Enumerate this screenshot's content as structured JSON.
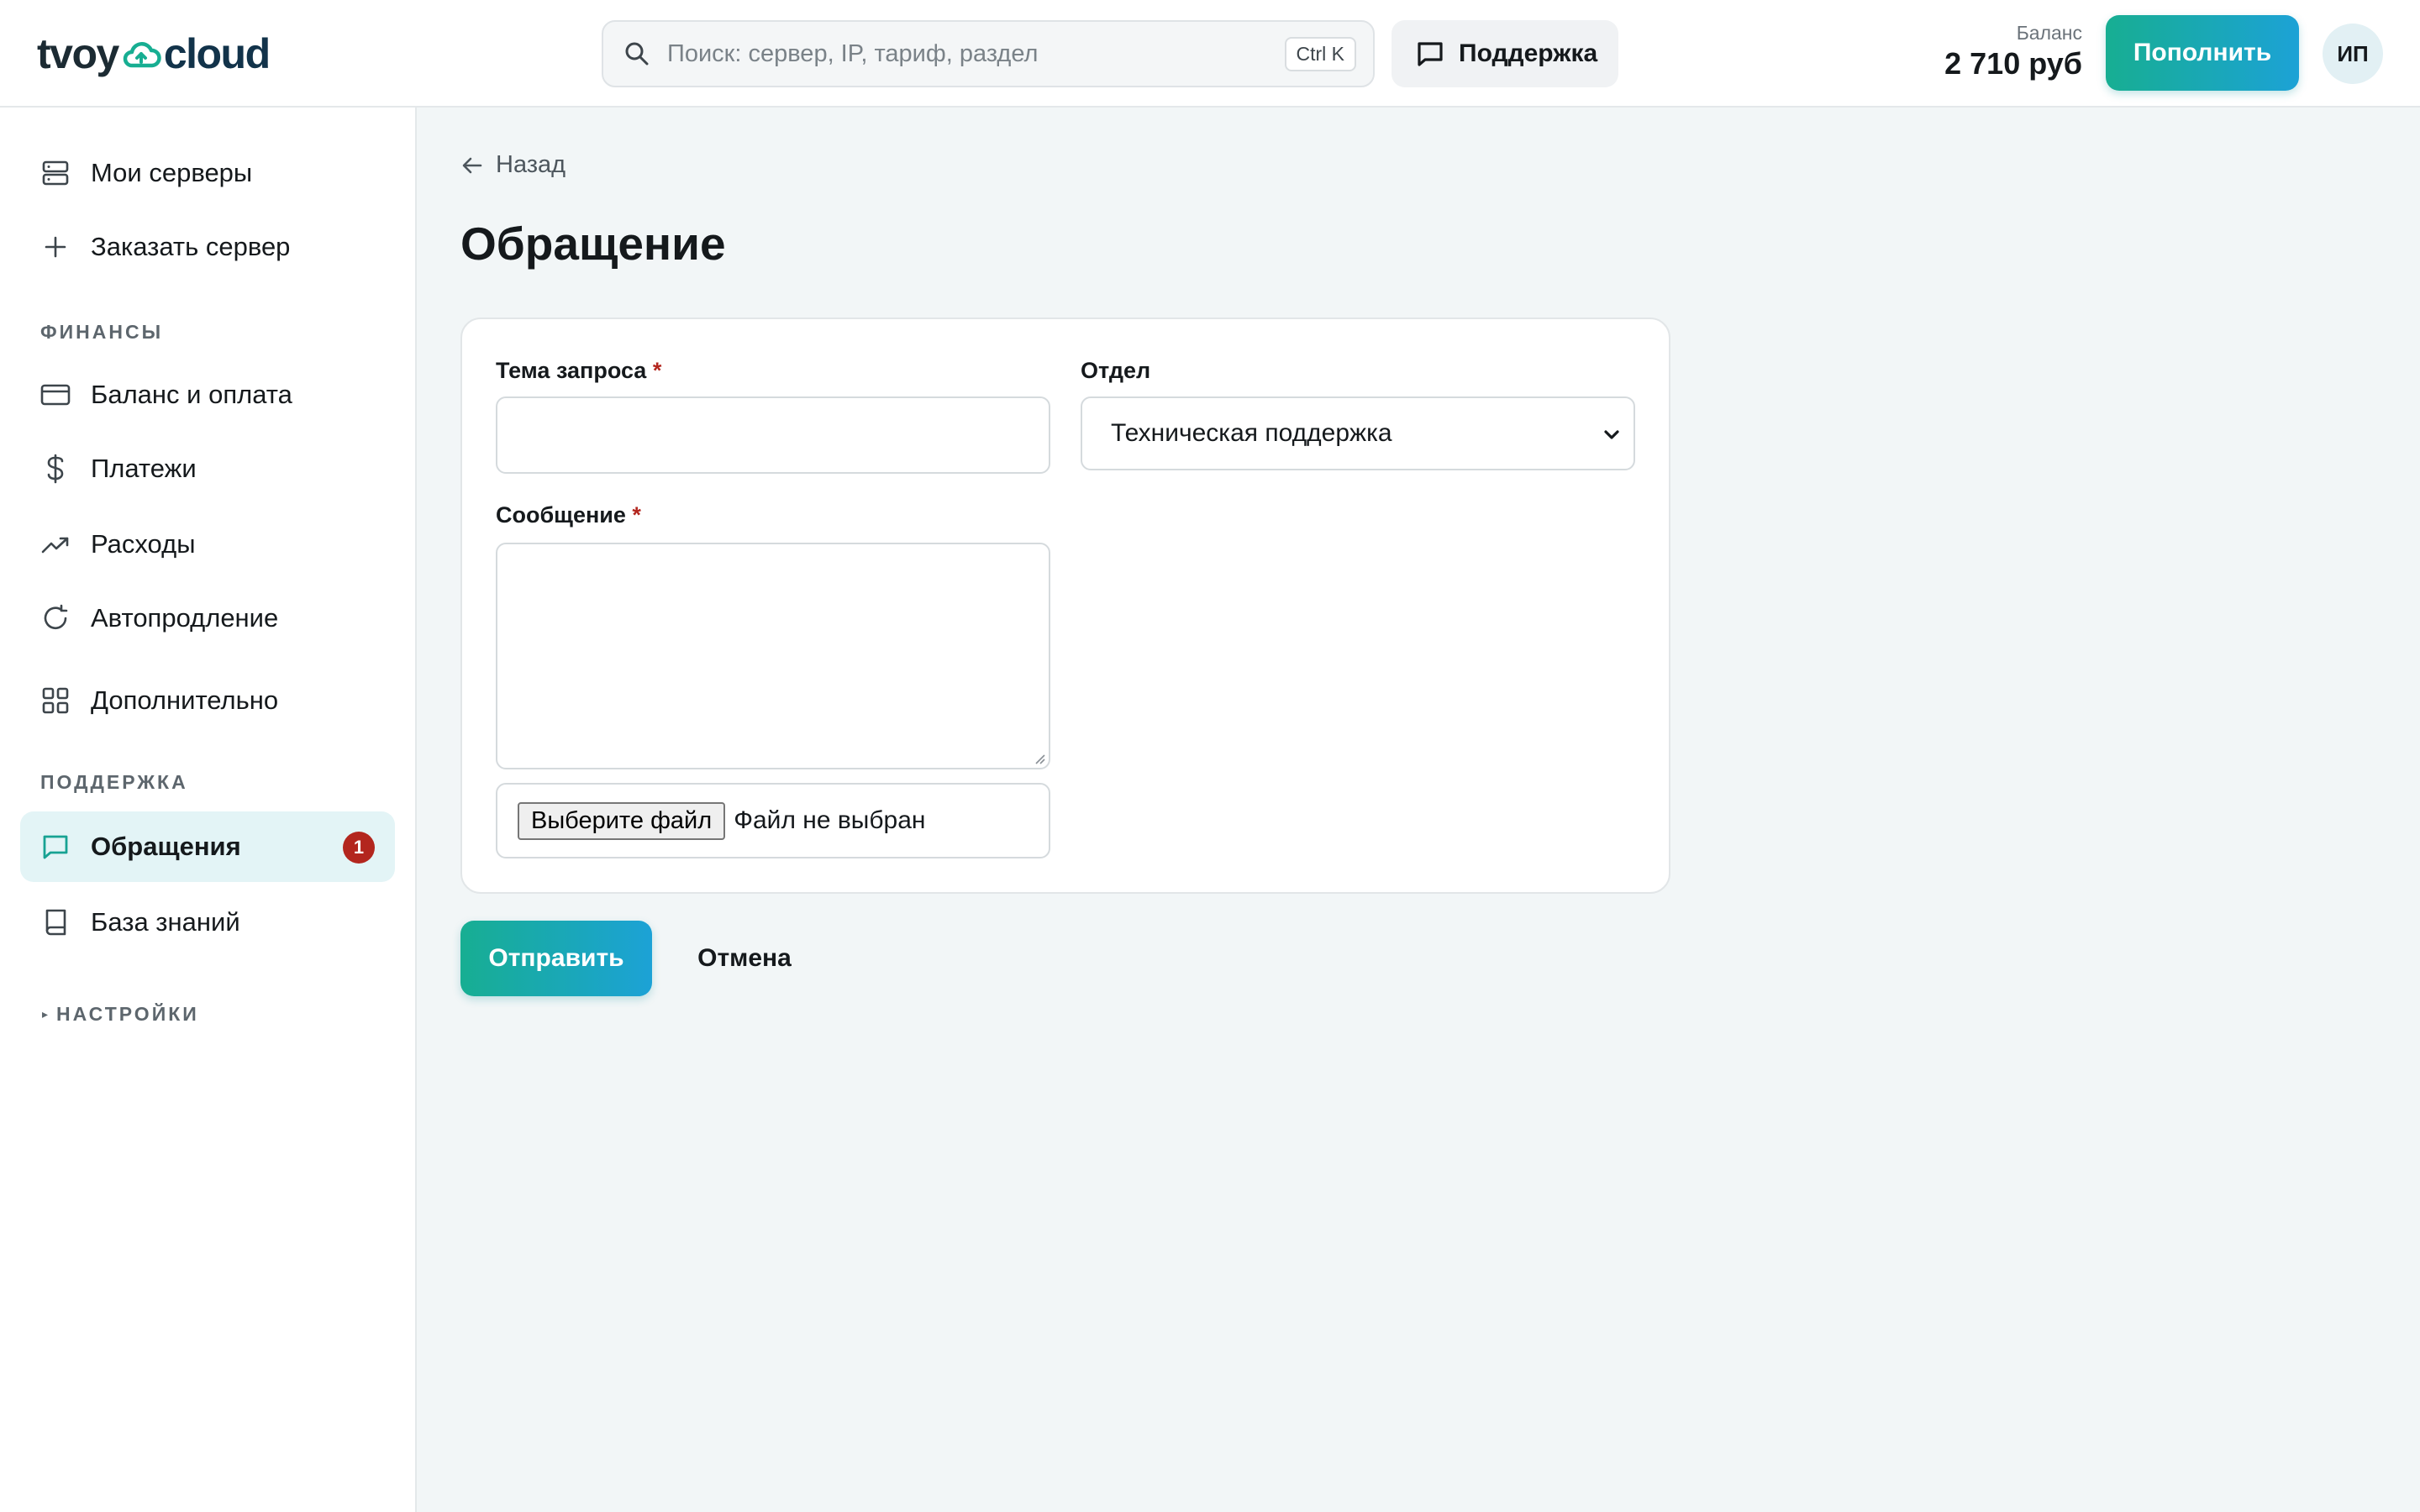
{
  "colors": {
    "accent_gradient_start": "#17ae92",
    "accent_gradient_end": "#1ca2d6",
    "active_nav_bg": "#e3f4f6",
    "badge": "#b3261e",
    "required_mark": "#b3261e",
    "background": "#f2f6f7"
  },
  "header": {
    "logo_part1": "tvoy",
    "logo_part2": "cloud",
    "logo_icon": "cloud-icon",
    "search": {
      "placeholder": "Поиск: сервер, IP, тариф, раздел",
      "shortcut": "Ctrl K",
      "icon": "search-icon"
    },
    "support_label": "Поддержка",
    "support_icon": "chat-icon",
    "balance_caption": "Баланс",
    "balance_value": "2 710 руб",
    "topup_label": "Пополнить",
    "avatar_initials": "ИП"
  },
  "sidebar": {
    "items_top": [
      {
        "label": "Мои серверы",
        "icon": "server-icon"
      },
      {
        "label": "Заказать сервер",
        "icon": "plus-icon"
      }
    ],
    "finance_label": "ФИНАНСЫ",
    "finance_items": [
      {
        "label": "Баланс и оплата",
        "icon": "card-icon"
      },
      {
        "label": "Платежи",
        "icon": "dollar-icon"
      },
      {
        "label": "Расходы",
        "icon": "trend-up-icon"
      },
      {
        "label": "Автопродление",
        "icon": "refresh-icon"
      },
      {
        "label": "Дополнительно",
        "icon": "grid-icon"
      }
    ],
    "support_label": "ПОДДЕРЖКА",
    "support_items": [
      {
        "label": "Обращения",
        "icon": "chat-icon",
        "badge": "1",
        "active": true
      },
      {
        "label": "База знаний",
        "icon": "book-icon"
      }
    ],
    "settings_marker": "▸",
    "settings_label": "НАСТРОЙКИ"
  },
  "main": {
    "back_label": "Назад",
    "title": "Обращение",
    "form": {
      "subject_label": "Тема запроса",
      "subject_value": "",
      "required_mark": "*",
      "department_label": "Отдел",
      "department_value": "Техническая поддержка",
      "message_label": "Сообщение",
      "message_value": "",
      "file_button": "Выберите файл",
      "file_status": "Файл не выбран"
    },
    "submit_label": "Отправить",
    "cancel_label": "Отмена"
  }
}
